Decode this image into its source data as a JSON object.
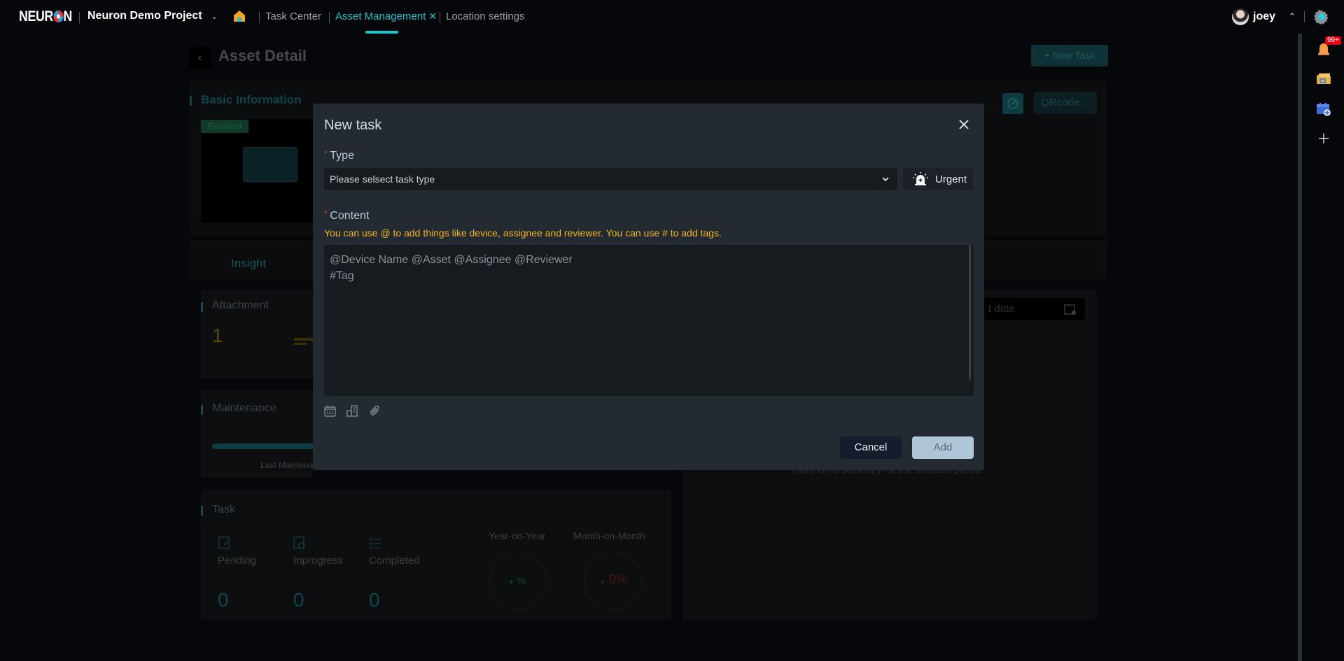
{
  "topbar": {
    "logo": "NEURON",
    "project": "Neuron Demo Project",
    "home_icon": "home-icon",
    "tabs": [
      {
        "label": "Task Center",
        "active": false
      },
      {
        "label": "Asset Management",
        "active": true,
        "closable": true
      },
      {
        "label": "Location settings",
        "active": false
      }
    ],
    "user": "joey",
    "accent_color": "#22c3c9"
  },
  "right_rail": {
    "notification_badge": "99+",
    "icons": [
      "bell-icon",
      "folder-icon",
      "calendar-add-icon",
      "plus-icon"
    ]
  },
  "page": {
    "title": "Asset Detail",
    "new_task_button": "New Task",
    "basic_info": {
      "title": "Basic Information",
      "status_badge": "Enabled",
      "qrcode_button": "QRcode"
    },
    "tabs": [
      "Insight"
    ],
    "attachment": {
      "title": "Attachment",
      "count": "1"
    },
    "maintenance": {
      "title": "Maintenance",
      "caption": "Last Maintena"
    },
    "task": {
      "title": "Task",
      "stats": [
        {
          "label": "Pending",
          "value": "0"
        },
        {
          "label": "Inprogress",
          "value": "0"
        },
        {
          "label": "Completed",
          "value": "0"
        }
      ],
      "year_on_year": {
        "label": "Year-on-Year",
        "value": "%"
      },
      "month_on_month": {
        "label": "Month-on-Month",
        "value": "0%"
      }
    },
    "summary": {
      "date_placeholder": "t date",
      "empty_text": "There is no summary for the selected period"
    }
  },
  "modal": {
    "title": "New task",
    "type_label": "Type",
    "type_placeholder": "Please selsect task type",
    "urgent_label": "Urgent",
    "content_label": "Content",
    "hint": "You can use @ to add things like device, assignee and reviewer. You can use # to add tags.",
    "content_placeholder": "@Device Name @Asset @Assignee @Reviewer\n#Tag",
    "tools": [
      "calendar-icon",
      "building-icon",
      "paperclip-icon"
    ],
    "cancel_label": "Cancel",
    "add_label": "Add"
  }
}
